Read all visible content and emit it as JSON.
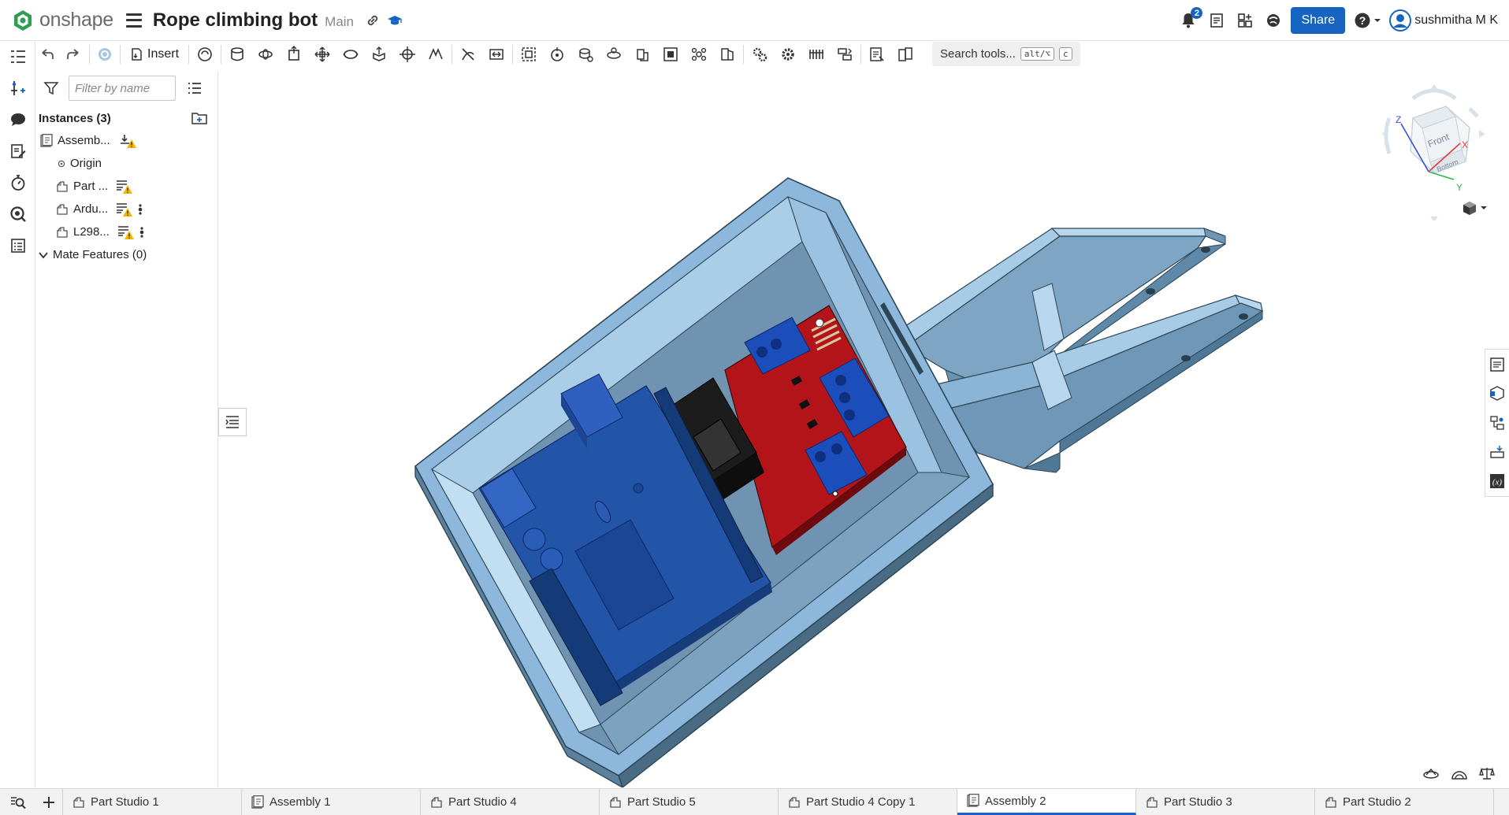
{
  "app": {
    "brand": "onshape",
    "document_title": "Rope climbing bot",
    "branch": "Main"
  },
  "header": {
    "share_label": "Share",
    "notification_count": "2",
    "user_name": "sushmitha M K",
    "brand_color": "#1565c0"
  },
  "toolbar": {
    "insert_label": "Insert",
    "search_label": "Search tools...",
    "search_shortcut_1": "alt/⌥",
    "search_shortcut_2": "c"
  },
  "panel": {
    "filter_placeholder": "Filter by name",
    "instances_header": "Instances (3)",
    "items": [
      {
        "label": "Assemb...",
        "icon": "assembly-icon"
      },
      {
        "label": "Origin",
        "icon": "origin-icon"
      },
      {
        "label": "Part ...",
        "icon": "part-icon"
      },
      {
        "label": "Ardu...",
        "icon": "part-icon"
      },
      {
        "label": "L298...",
        "icon": "part-icon"
      }
    ],
    "mate_features": "Mate Features (0)"
  },
  "viewcube": {
    "front_label": "Front",
    "bottom_label": "Bottom",
    "x_label": "X",
    "y_label": "Y",
    "z_label": "Z"
  },
  "tabs": [
    {
      "label": "Part Studio 1",
      "type": "part-studio",
      "active": false
    },
    {
      "label": "Assembly 1",
      "type": "assembly",
      "active": false
    },
    {
      "label": "Part Studio 4",
      "type": "part-studio",
      "active": false
    },
    {
      "label": "Part Studio 5",
      "type": "part-studio",
      "active": false
    },
    {
      "label": "Part Studio 4 Copy 1",
      "type": "part-studio",
      "active": false
    },
    {
      "label": "Assembly 2",
      "type": "assembly",
      "active": true
    },
    {
      "label": "Part Studio 3",
      "type": "part-studio",
      "active": false
    },
    {
      "label": "Part Studio 2",
      "type": "part-studio",
      "active": false
    }
  ]
}
